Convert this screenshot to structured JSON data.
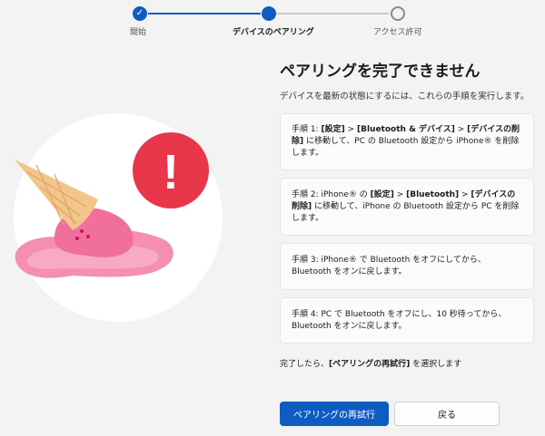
{
  "stepper": {
    "steps": [
      {
        "label": "開始",
        "state": "done"
      },
      {
        "label": "デバイスのペアリング",
        "state": "current"
      },
      {
        "label": "アクセス許可",
        "state": "pending"
      }
    ],
    "check_glyph": "✓"
  },
  "illustration": {
    "icon": "melted-ice-cream-error-icon",
    "alert_glyph": "!"
  },
  "main": {
    "title": "ペアリングを完了できません",
    "subtitle": "デバイスを最新の状態にするには、これらの手順を実行します。",
    "steps": [
      {
        "prefix": "手順 1: ",
        "parts": [
          "[設定]",
          " > ",
          "[Bluetooth & デバイス]",
          " > ",
          "[デバイスの削除]"
        ],
        "suffix": "に移動して、PC の Bluetooth 設定から iPhone® を削除します。"
      },
      {
        "prefix": "手順 2: iPhone® の ",
        "parts": [
          "[設定]",
          " > ",
          "[Bluetooth]",
          " > ",
          "[デバイスの削除]"
        ],
        "suffix": "に移動して、iPhone の Bluetooth 設定から PC を削除します。"
      },
      {
        "text": "手順 3: iPhone® で Bluetooth をオフにしてから、Bluetooth をオンに戻します。"
      },
      {
        "text": "手順 4: PC で Bluetooth をオフにし、10 秒待ってから、Bluetooth をオンに戻します。"
      }
    ],
    "done_prefix": "完了したら、",
    "done_bold": "[ペアリングの再試行]",
    "done_suffix": " を選択します"
  },
  "buttons": {
    "retry_label": "ペアリングの再試行",
    "back_label": "戻る"
  },
  "colors": {
    "accent": "#0f5cc1",
    "alert_red": "#e8364b",
    "ice_cream_pink": "#f48fb1",
    "cone": "#f3c58a",
    "background": "#f3f3f3"
  }
}
